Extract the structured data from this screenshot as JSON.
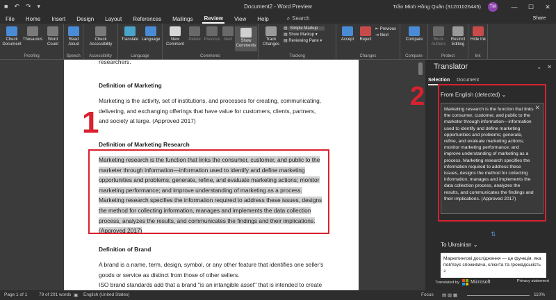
{
  "titlebar": {
    "doc_title": "Document2 - Word Preview",
    "user": "Trần Minh Hồng Quân (31201026445)",
    "avatar_initials": "TM"
  },
  "menu": {
    "items": [
      "File",
      "Home",
      "Insert",
      "Design",
      "Layout",
      "References",
      "Mailings",
      "Review",
      "View",
      "Help"
    ],
    "active": "Review",
    "search": "Search",
    "share": "Share"
  },
  "ribbon": {
    "proofing": {
      "label": "Proofing",
      "check_document": "Check Document",
      "thesaurus": "Thesaurus",
      "word_count": "Word Count"
    },
    "speech": {
      "label": "Speech",
      "read_aloud": "Read Aloud"
    },
    "accessibility": {
      "label": "Accessibility",
      "check_accessibility": "Check Accessibility"
    },
    "language": {
      "label": "Language",
      "translate": "Translate",
      "language": "Language"
    },
    "comments": {
      "label": "Comments",
      "new_comment": "New Comment",
      "delete": "Delete",
      "previous": "Previous",
      "next": "Next",
      "show_comments": "Show Comments"
    },
    "tracking": {
      "label": "Tracking",
      "track_changes": "Track Changes",
      "simple_markup": "Simple Markup",
      "show_markup": "Show Markup",
      "reviewing_pane": "Reviewing Pane"
    },
    "changes": {
      "label": "Changes",
      "accept": "Accept",
      "reject": "Reject",
      "previous": "Previous",
      "next": "Next"
    },
    "compare": {
      "label": "Compare",
      "compare": "Compare"
    },
    "protect": {
      "label": "Protect",
      "block_authors": "Block Authors",
      "restrict_editing": "Restrict Editing"
    },
    "ink": {
      "label": "Ink",
      "hide_ink": "Hide Ink"
    }
  },
  "document": {
    "line0": "researchers.",
    "h1": "Definition of Marketing",
    "p1": [
      "Marketing is the activity, set of institutions, and processes for creating, communicating,",
      "delivering, and exchanging offerings that have value for customers, clients, partners,",
      "and society at large. (Approved 2017)"
    ],
    "h2": "Definition of Marketing Research",
    "p2": [
      "Marketing research is the function that links the consumer, customer, and public to the",
      "marketer through information—information used to identify and define marketing",
      "opportunities and problems; generate, refine, and evaluate marketing actions; monitor",
      "marketing performance; and improve understanding of marketing as a process.",
      "Marketing research specifies the information required to address these issues, designs",
      "the method for collecting information, manages and implements the data collection",
      "process, analyzes the results, and communicates the findings and their implications.",
      "(Approved 2017)"
    ],
    "h3": "Definition of Brand",
    "p3": [
      "A brand is a name, term, design, symbol, or any other feature that identifies one seller's",
      "goods or service as distinct from those of other sellers.",
      "ISO brand standards add that a brand \"is an intangible asset\" that is intended to create"
    ]
  },
  "annotations": {
    "num1": "1",
    "num2": "2"
  },
  "statusbar": {
    "page": "Page 1 of 1",
    "words": "79 of 201 words",
    "language": "English (United States)",
    "focus": "Focus",
    "zoom": "110%"
  },
  "translator": {
    "title": "Translator",
    "tabs": [
      "Selection",
      "Document"
    ],
    "from_label": "From",
    "from_lang": "English (detected)",
    "source_text": "Marketing research is the function that links the consumer, customer, and public to the marketer through information—information used to identify and define marketing opportunities and problems; generate, refine, and evaluate marketing actions; monitor marketing performance; and improve understanding of marketing as a process. Marketing research specifies the information required to address these issues, designs the method for collecting information, manages and implements the data collection process, analyzes the results, and communicates the findings and their implications. (Approved 2017)",
    "to_label": "To",
    "to_lang": "Ukrainian",
    "target_text": "Маркетингові дослідження — це функція, яка пов'язує споживача, клієнта та громадськість з",
    "footer_left": "Translated by",
    "footer_brand": "Microsoft",
    "footer_right": "Privacy statement"
  }
}
